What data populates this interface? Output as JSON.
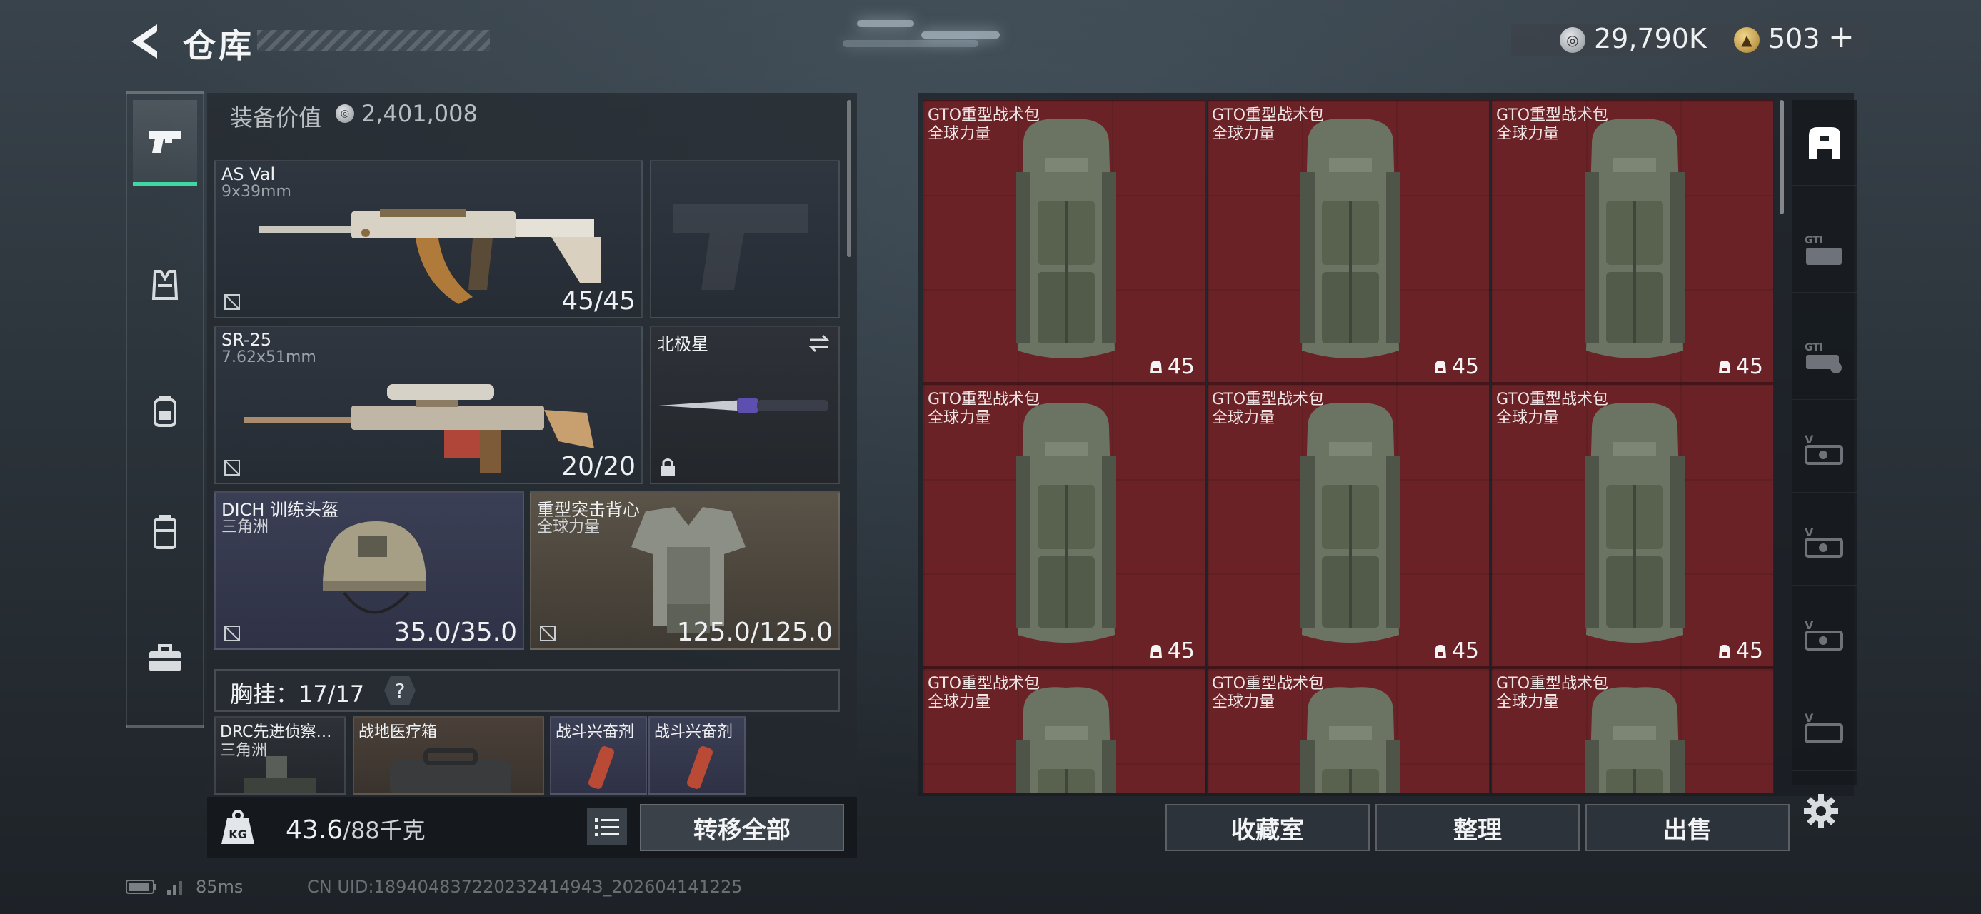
{
  "header": {
    "title": "仓库",
    "silver_amount": "29,790K",
    "gold_amount": "503",
    "plus_label": "+"
  },
  "categories": [
    {
      "icon": "pistol-icon",
      "active": true
    },
    {
      "icon": "vest-icon",
      "active": false
    },
    {
      "icon": "backpack-icon",
      "active": false
    },
    {
      "icon": "chest-rig-icon",
      "active": false
    },
    {
      "icon": "toolbox-icon",
      "active": false
    }
  ],
  "equipment": {
    "value_label": "装备价值",
    "value": "2,401,008",
    "primary_weapon": {
      "name": "AS Val",
      "caliber": "9x39mm",
      "ammo": "45/45"
    },
    "secondary_weapon": {
      "name": "SR-25",
      "caliber": "7.62x51mm",
      "ammo": "20/20"
    },
    "melee": {
      "name": "北极星"
    },
    "helmet": {
      "name": "DICH 训练头盔",
      "sub": "三角洲",
      "durability": "35.0/35.0"
    },
    "armor": {
      "name": "重型突击背心",
      "sub": "全球力量",
      "durability": "125.0/125.0"
    },
    "chest_rig": {
      "label": "胸挂：17/17",
      "help": "?"
    },
    "rig_items": [
      {
        "name": "DRC先进侦察…",
        "sub": "三角洲"
      },
      {
        "name": "战地医疗箱",
        "sub": ""
      },
      {
        "name": "战斗兴奋剂",
        "sub": ""
      },
      {
        "name": "战斗兴奋剂",
        "sub": ""
      }
    ],
    "weight": "43.6",
    "weight_max": "/88千克",
    "transfer_all": "转移全部"
  },
  "storage": {
    "items": [
      {
        "name": "GTO重型战术包",
        "sub": "全球力量",
        "count": "45"
      },
      {
        "name": "GTO重型战术包",
        "sub": "全球力量",
        "count": "45"
      },
      {
        "name": "GTO重型战术包",
        "sub": "全球力量",
        "count": "45"
      },
      {
        "name": "GTO重型战术包",
        "sub": "全球力量",
        "count": "45"
      },
      {
        "name": "GTO重型战术包",
        "sub": "全球力量",
        "count": "45"
      },
      {
        "name": "GTO重型战术包",
        "sub": "全球力量",
        "count": "45"
      },
      {
        "name": "GTO重型战术包",
        "sub": "全球力量",
        "count": ""
      },
      {
        "name": "GTO重型战术包",
        "sub": "全球力量",
        "count": ""
      },
      {
        "name": "GTO重型战术包",
        "sub": "全球力量",
        "count": ""
      }
    ],
    "buttons": {
      "collection": "收藏室",
      "organize": "整理",
      "sell": "出售"
    }
  },
  "filters": [
    "all-storage-icon",
    "gti-case-icon",
    "gti-key-icon",
    "v-case-icon",
    "v-case-icon",
    "v-case-icon",
    "v-case-icon"
  ],
  "status": {
    "ping": "85ms",
    "uid": "CN UID:18940483722023241494З_202604141225"
  },
  "colors": {
    "accent": "#3fd7a2",
    "storage_cell": "#6b2227"
  }
}
